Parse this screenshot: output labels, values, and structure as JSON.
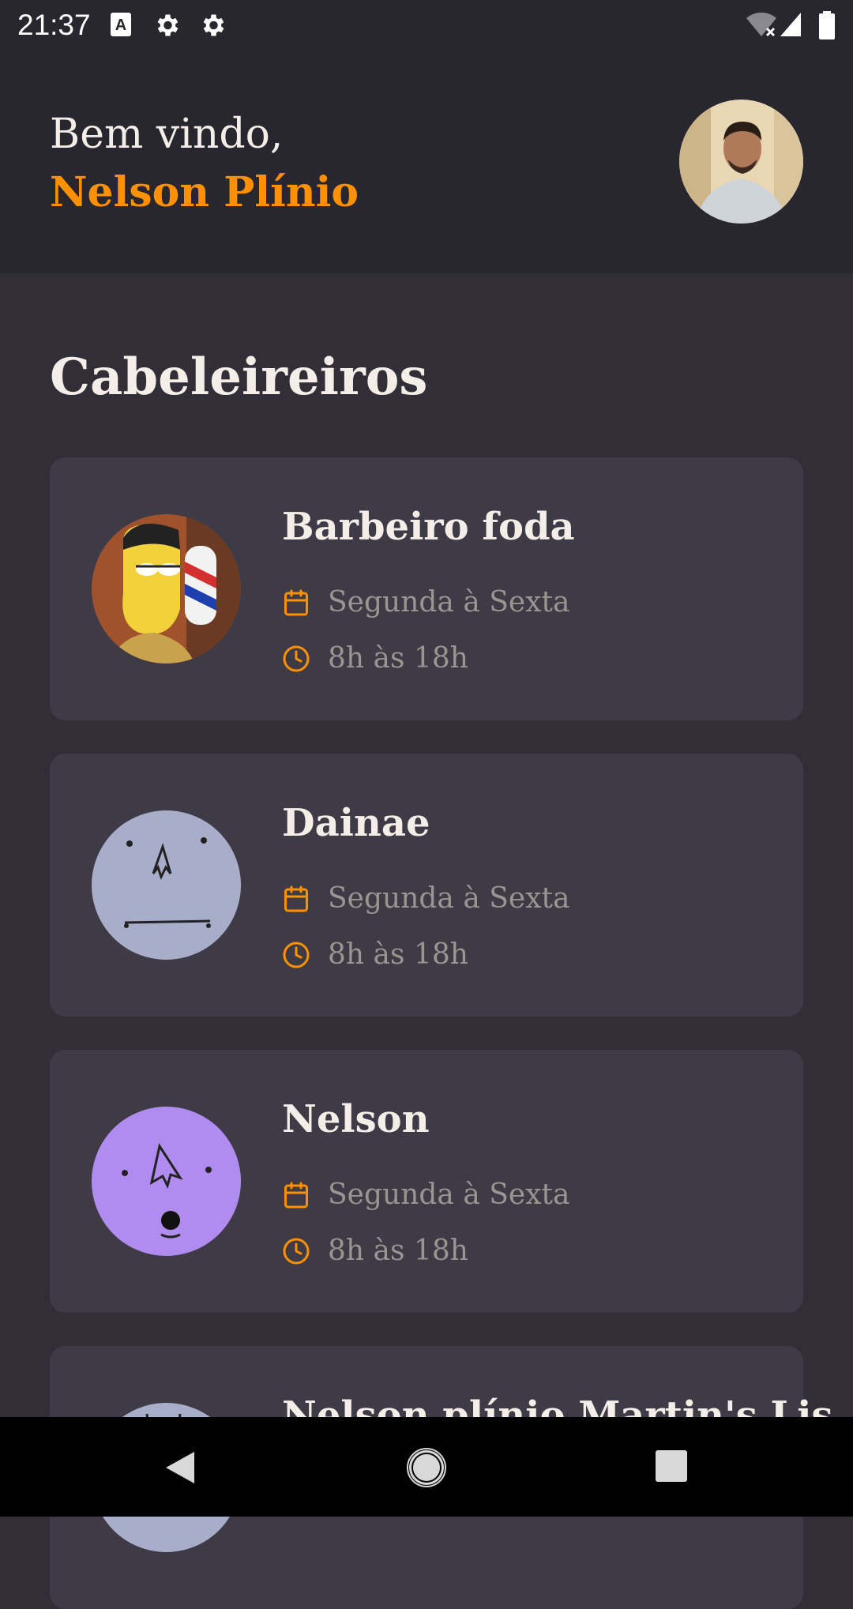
{
  "status_bar": {
    "time": "21:37",
    "icons": [
      "font-a-icon",
      "gear-icon",
      "gear-icon",
      "wifi-off-icon",
      "signal-icon",
      "battery-icon"
    ]
  },
  "header": {
    "greeting": "Bem vindo,",
    "user_name": "Nelson Plínio"
  },
  "section": {
    "title": "Cabeleireiros"
  },
  "providers": [
    {
      "name": "Barbeiro foda",
      "days": "Segunda à Sexta",
      "hours": "8h às 18h"
    },
    {
      "name": "Dainae",
      "days": "Segunda à Sexta",
      "hours": "8h às 18h"
    },
    {
      "name": "Nelson",
      "days": "Segunda à Sexta",
      "hours": "8h às 18h"
    },
    {
      "name": "Nelson plínio Martin's Lis",
      "days": "",
      "hours": ""
    }
  ],
  "navigation": {
    "buttons": [
      "back-icon",
      "home-icon",
      "recents-icon"
    ]
  },
  "colors": {
    "accent": "#ff9000",
    "background": "#312e38",
    "header": "#28262e",
    "card": "#3e3b47",
    "text": "#f4ede8",
    "muted": "#999591"
  }
}
